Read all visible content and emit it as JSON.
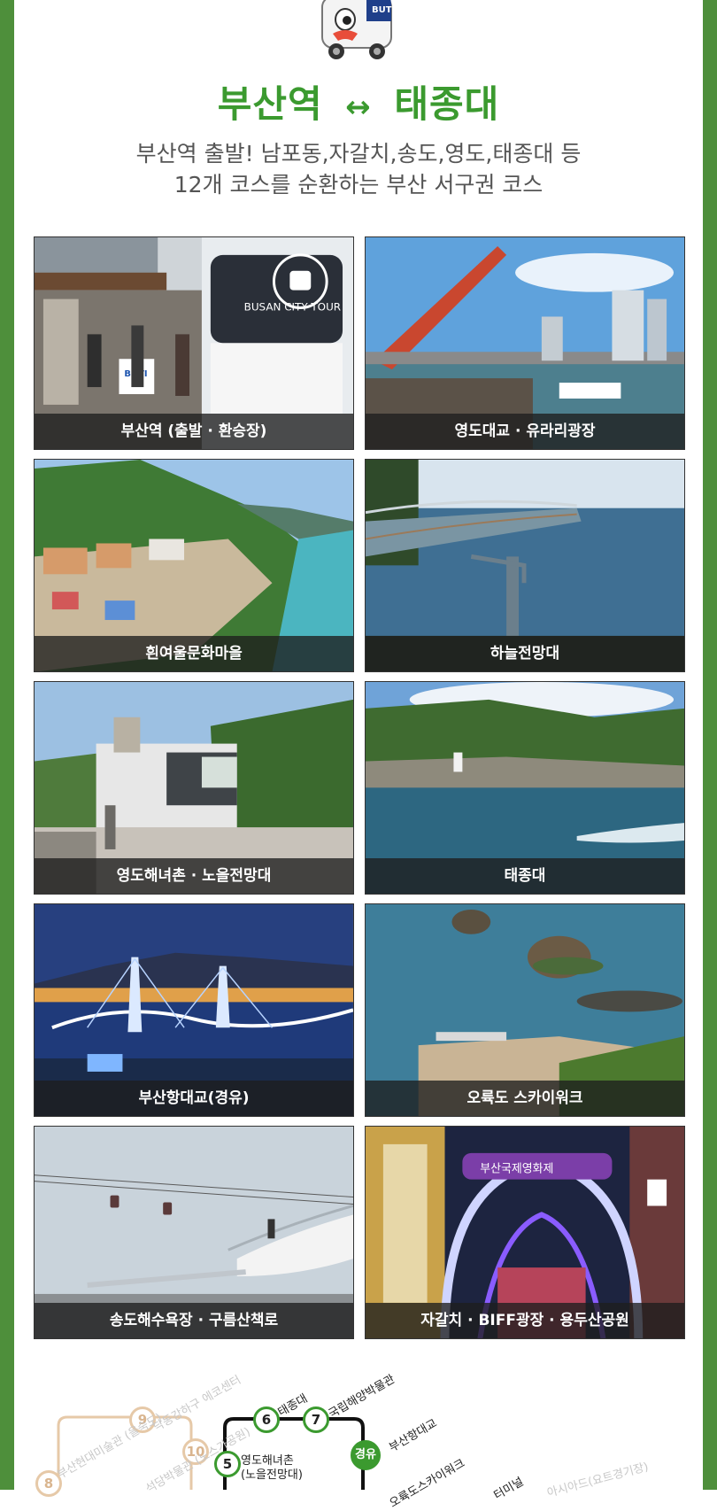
{
  "header": {
    "title_from": "부산역",
    "title_arrow": "↔",
    "title_to": "태종대",
    "subtitle_line1": "부산역 출발! 남포동,자갈치,송도,영도,태종대 등",
    "subtitle_line2": "12개 코스를 순환하는 부산 서구권 코스"
  },
  "tiles": [
    {
      "caption": "부산역 (출발 · 환승장)"
    },
    {
      "caption": "영도대교 · 유라리광장"
    },
    {
      "caption": "흰여울문화마을"
    },
    {
      "caption": "하늘전망대"
    },
    {
      "caption": "영도해녀촌 · 노을전망대"
    },
    {
      "caption": "태종대"
    },
    {
      "caption": "부산항대교(경유)"
    },
    {
      "caption": "오륙도 스카이워크"
    },
    {
      "caption": "송도해수욕장 · 구름산책로"
    },
    {
      "caption": "자갈치 · BIFF광장 · 용두산공원"
    }
  ],
  "photo_text": {
    "bus_sign": "BUSAN CITY TOUR",
    "buti_sign": "BUTI",
    "biff_sign": "부산국제영화제"
  },
  "route_map": {
    "labels": {
      "taejongdae": "태종대",
      "museum": "국립해양박물관",
      "busan_bridge": "부산항대교",
      "haenyeo_1": "영도해녀촌",
      "haenyeo_2": "(노을전망대)",
      "skywalk": "오륙도스카이워크",
      "terminal": "터미널",
      "nakdong": "낙동강하구 에코센터",
      "museum2": "석당박물관 (노스가공원)",
      "sea": "부산현대미술관 (을숙도)",
      "stadium": "아시아드(요트경기장)"
    },
    "stops": {
      "s5": "5",
      "s6": "6",
      "s7": "7",
      "transfer": "경유",
      "s8": "8",
      "s9": "9",
      "s10": "10"
    }
  },
  "colors": {
    "brand_green": "#3b9a2f",
    "border_green": "#4e8f3b",
    "caption_bg": "#1e1e1e"
  }
}
